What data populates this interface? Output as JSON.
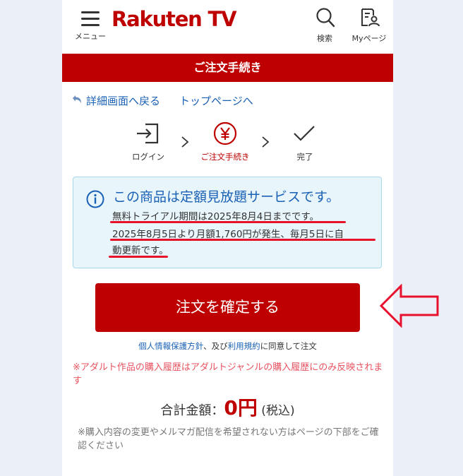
{
  "header": {
    "menu_label": "メニュー",
    "logo_text": "Rakuten TV",
    "search_label": "検索",
    "mypage_label": "Myページ"
  },
  "banner": {
    "title": "ご注文手続き"
  },
  "nav": {
    "back_label": "詳細画面へ戻る",
    "top_label": "トップページへ"
  },
  "steps": [
    {
      "label": "ログイン",
      "icon": "login-icon",
      "state": "done"
    },
    {
      "label": "ご注文手続き",
      "icon": "yen-icon",
      "state": "current"
    },
    {
      "label": "完了",
      "icon": "check-icon",
      "state": "upcoming"
    }
  ],
  "info": {
    "icon": "info-icon",
    "title": "この商品は定額見放題サービスです。",
    "line1": "無料トライアル期間は2025年8月4日までです。",
    "line2": "2025年8月5日より月額1,760円が発生、毎月5日に自",
    "line3": "動更新です。"
  },
  "confirm_button": {
    "label": "注文を確定する"
  },
  "agreement": {
    "privacy_link": "個人情報保護方針",
    "and_text": "、及び",
    "terms_link": "利用規約",
    "suffix": "に同意して注文"
  },
  "warning_text": "※アダルト作品の購入履歴はアダルトジャンルの購入履歴にのみ反映されます",
  "total": {
    "label": "合計金額：",
    "amount": "0円",
    "tax": " (税込)"
  },
  "note_text": "※購入内容の変更やメルマガ配信を希望されない方はページの下部をご確認ください",
  "colors": {
    "brand_red": "#bf0000",
    "link_blue": "#1a61b5",
    "annotation_red": "#e8112d",
    "info_bg": "#e8f5fb"
  }
}
